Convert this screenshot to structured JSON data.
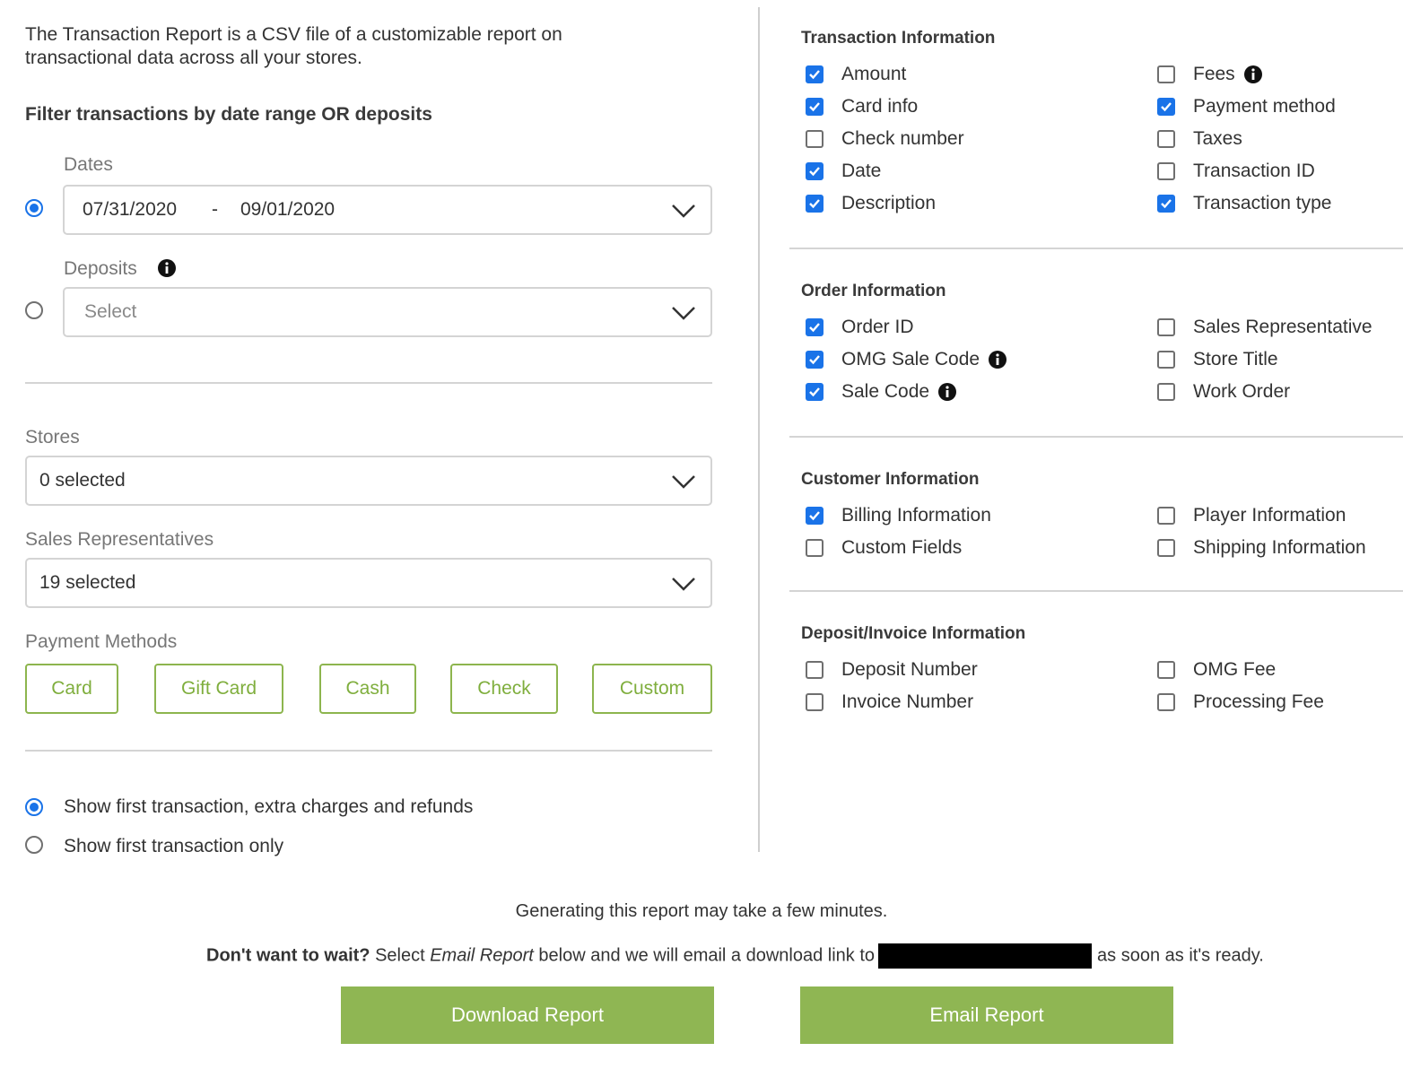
{
  "intro": {
    "line1": "The Transaction Report is a CSV file of a customizable report on",
    "line2": "transactional data across all your stores."
  },
  "filter": {
    "heading": "Filter transactions by date range OR deposits",
    "mode": "dates",
    "dates": {
      "label": "Dates",
      "start": "07/31/2020",
      "separator": "-",
      "end": "09/01/2020"
    },
    "deposits": {
      "label": "Deposits",
      "placeholder": "Select"
    }
  },
  "stores": {
    "label": "Stores",
    "value": "0 selected"
  },
  "sales_reps": {
    "label": "Sales Representatives",
    "value": "19 selected"
  },
  "payment_methods": {
    "label": "Payment Methods",
    "options": [
      "Card",
      "Gift Card",
      "Cash",
      "Check",
      "Custom"
    ]
  },
  "transaction_scope": {
    "selected": "all",
    "options": [
      {
        "label": "Show first transaction, extra charges and refunds",
        "checked": true
      },
      {
        "label": "Show first transaction only",
        "checked": false
      }
    ]
  },
  "sections": [
    {
      "title": "Transaction Information",
      "left": [
        {
          "label": "Amount",
          "checked": true
        },
        {
          "label": "Card info",
          "checked": true
        },
        {
          "label": "Check number",
          "checked": false
        },
        {
          "label": "Date",
          "checked": true
        },
        {
          "label": "Description",
          "checked": true
        }
      ],
      "right": [
        {
          "label": "Fees",
          "checked": false,
          "info": true
        },
        {
          "label": "Payment method",
          "checked": true
        },
        {
          "label": "Taxes",
          "checked": false
        },
        {
          "label": "Transaction ID",
          "checked": false
        },
        {
          "label": "Transaction type",
          "checked": true
        }
      ]
    },
    {
      "title": "Order Information",
      "left": [
        {
          "label": "Order ID",
          "checked": true
        },
        {
          "label": "OMG Sale Code",
          "checked": true,
          "info": true
        },
        {
          "label": "Sale Code",
          "checked": true,
          "info": true
        }
      ],
      "right": [
        {
          "label": "Sales Representative",
          "checked": false
        },
        {
          "label": "Store Title",
          "checked": false
        },
        {
          "label": "Work Order",
          "checked": false
        }
      ]
    },
    {
      "title": "Customer Information",
      "left": [
        {
          "label": "Billing Information",
          "checked": true
        },
        {
          "label": "Custom Fields",
          "checked": false
        }
      ],
      "right": [
        {
          "label": "Player Information",
          "checked": false
        },
        {
          "label": "Shipping Information",
          "checked": false
        }
      ]
    },
    {
      "title": "Deposit/Invoice Information",
      "left": [
        {
          "label": "Deposit Number",
          "checked": false
        },
        {
          "label": "Invoice Number",
          "checked": false
        }
      ],
      "right": [
        {
          "label": "OMG Fee",
          "checked": false
        },
        {
          "label": "Processing Fee",
          "checked": false
        }
      ]
    }
  ],
  "footer": {
    "notice": "Generating this report may take a few minutes.",
    "wait_bold": "Don't want to wait?",
    "wait_pre": " Select ",
    "wait_italic": "Email Report",
    "wait_mid": " below and we will email a download link to",
    "wait_post": "as soon as it's ready.",
    "download_label": "Download Report",
    "email_label": "Email Report"
  },
  "colors": {
    "accent_blue": "#1a73e8",
    "brand_green": "#8fb653",
    "outline_green": "#8db54e"
  },
  "icons": {
    "info": "info-circle-icon",
    "chevron": "chevron-down-icon",
    "check": "checkmark-icon"
  }
}
